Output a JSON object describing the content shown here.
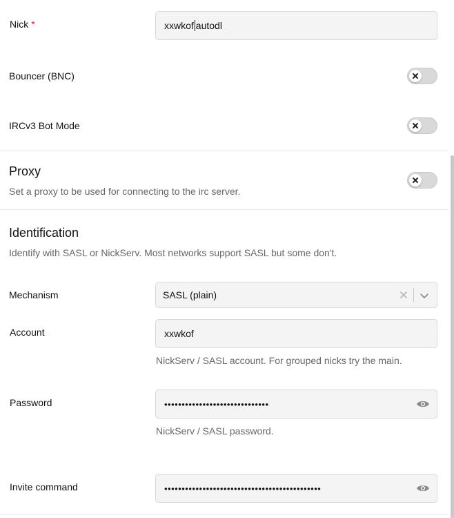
{
  "nick": {
    "label": "Nick",
    "required_mark": "*",
    "value_before_cursor": "xxwkof",
    "value_after_cursor": "autodl"
  },
  "bouncer": {
    "label": "Bouncer (BNC)",
    "enabled": false
  },
  "bot_mode": {
    "label": "IRCv3 Bot Mode",
    "enabled": false
  },
  "proxy": {
    "title": "Proxy",
    "description": "Set a proxy to be used for connecting to the irc server.",
    "enabled": false
  },
  "identification": {
    "title": "Identification",
    "description": "Identify with SASL or NickServ. Most networks support SASL but some don't."
  },
  "mechanism": {
    "label": "Mechanism",
    "value": "SASL (plain)"
  },
  "account": {
    "label": "Account",
    "value": "xxwkof",
    "help": "NickServ / SASL account. For grouped nicks try the main."
  },
  "password": {
    "label": "Password",
    "masked_value": "••••••••••••••••••••••••••••••",
    "help": "NickServ / SASL password."
  },
  "invite_command": {
    "label": "Invite command",
    "masked_value": "•••••••••••••••••••••••••••••••••••••••••••••"
  },
  "colors": {
    "toggle_off": "#d9d9d9",
    "input_bg": "#f4f4f4",
    "required": "#e11d48"
  }
}
